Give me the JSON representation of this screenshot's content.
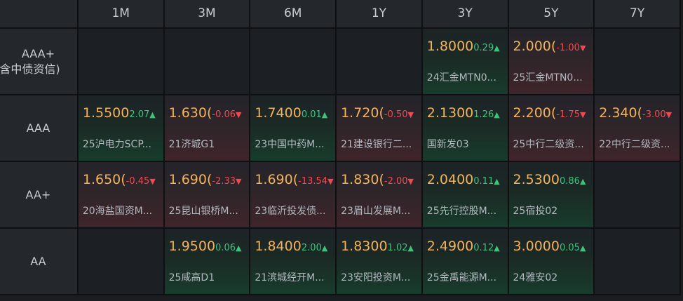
{
  "columns": [
    "1M",
    "3M",
    "6M",
    "1Y",
    "3Y",
    "5Y",
    "7Y"
  ],
  "rows": [
    {
      "label_line1": "AAA+",
      "label_line2": "(含中债资信)",
      "cells": [
        null,
        null,
        null,
        null,
        {
          "rate": "1.8000",
          "change": "0.29",
          "dir": "up",
          "bond": "24汇金MTN0..."
        },
        {
          "rate": "2.000(",
          "change": "-1.00",
          "dir": "down",
          "bond": "25汇金MTN0..."
        },
        null
      ]
    },
    {
      "label_line1": "AAA",
      "label_line2": "",
      "cells": [
        {
          "rate": "1.5500",
          "change": "2.07",
          "dir": "up",
          "bond": "25沪电力SCP..."
        },
        {
          "rate": "1.630(",
          "change": "-0.06",
          "dir": "down",
          "bond": "21济城G1"
        },
        {
          "rate": "1.7400",
          "change": "0.01",
          "dir": "up",
          "bond": "23中国中药M..."
        },
        {
          "rate": "1.720(",
          "change": "-0.50",
          "dir": "down",
          "bond": "21建设银行二..."
        },
        {
          "rate": "2.1300",
          "change": "1.26",
          "dir": "up",
          "bond": "国新发03"
        },
        {
          "rate": "2.200(",
          "change": "-1.75",
          "dir": "down",
          "bond": "25中行二级资..."
        },
        {
          "rate": "2.340(",
          "change": "-3.00",
          "dir": "down",
          "bond": "22中行二级资..."
        }
      ]
    },
    {
      "label_line1": "AA+",
      "label_line2": "",
      "cells": [
        {
          "rate": "1.650(",
          "change": "-0.45",
          "dir": "down",
          "bond": "20海盐国资M..."
        },
        {
          "rate": "1.690(",
          "change": "-2.33",
          "dir": "down",
          "bond": "25昆山银桥M..."
        },
        {
          "rate": "1.690(",
          "change": "-13.54",
          "dir": "down",
          "bond": "23临沂投发债..."
        },
        {
          "rate": "1.830(",
          "change": "-2.00",
          "dir": "down",
          "bond": "23眉山发展M..."
        },
        {
          "rate": "2.0400",
          "change": "0.11",
          "dir": "up",
          "bond": "25先行控股M..."
        },
        {
          "rate": "2.5300",
          "change": "0.86",
          "dir": "up",
          "bond": "25宿投02"
        },
        null
      ]
    },
    {
      "label_line1": "AA",
      "label_line2": "",
      "cells": [
        null,
        {
          "rate": "1.9500",
          "change": "0.06",
          "dir": "up",
          "bond": "25咸高D1"
        },
        {
          "rate": "1.8400",
          "change": "2.00",
          "dir": "up",
          "bond": "21滨城经开M..."
        },
        {
          "rate": "1.8300",
          "change": "1.02",
          "dir": "up",
          "bond": "23安阳投资M..."
        },
        {
          "rate": "2.4900",
          "change": "0.12",
          "dir": "up",
          "bond": "25金禹能源M..."
        },
        {
          "rate": "3.0000",
          "change": "0.05",
          "dir": "up",
          "bond": "24雅安02"
        },
        null
      ]
    }
  ],
  "icons": {
    "up": "triangle-up-icon",
    "down": "triangle-down-icon"
  },
  "colors": {
    "rate": "#f2b35a",
    "up": "#3cc47c",
    "down": "#ee4a52"
  }
}
